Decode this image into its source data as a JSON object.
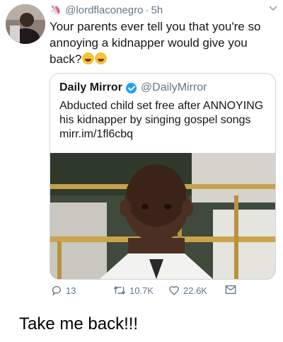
{
  "tweet": {
    "handle": "@lordflaconegro",
    "separator": "·",
    "time": "5h",
    "text": "Your parents ever tell you that you're so annoying a kidnapper would give you back?",
    "quoted": {
      "name": "Daily Mirror",
      "handle": "@DailyMirror",
      "text": "Abducted child set free after ANNOYING his kidnapper by singing gospel songs mirr.im/1fl6cbq"
    },
    "actions": {
      "replies": "13",
      "retweets": "10.7K",
      "likes": "22.6K"
    }
  },
  "caption": "Take me back!!!",
  "colors": {
    "verified": "#1da1f2",
    "muted": "#657786",
    "border": "#ccd6dd"
  },
  "icons": [
    "unicorn-icon",
    "chevron-down-icon",
    "verified-badge-icon",
    "reply-icon",
    "retweet-icon",
    "like-icon",
    "message-icon",
    "laughing-emoji-icon"
  ]
}
